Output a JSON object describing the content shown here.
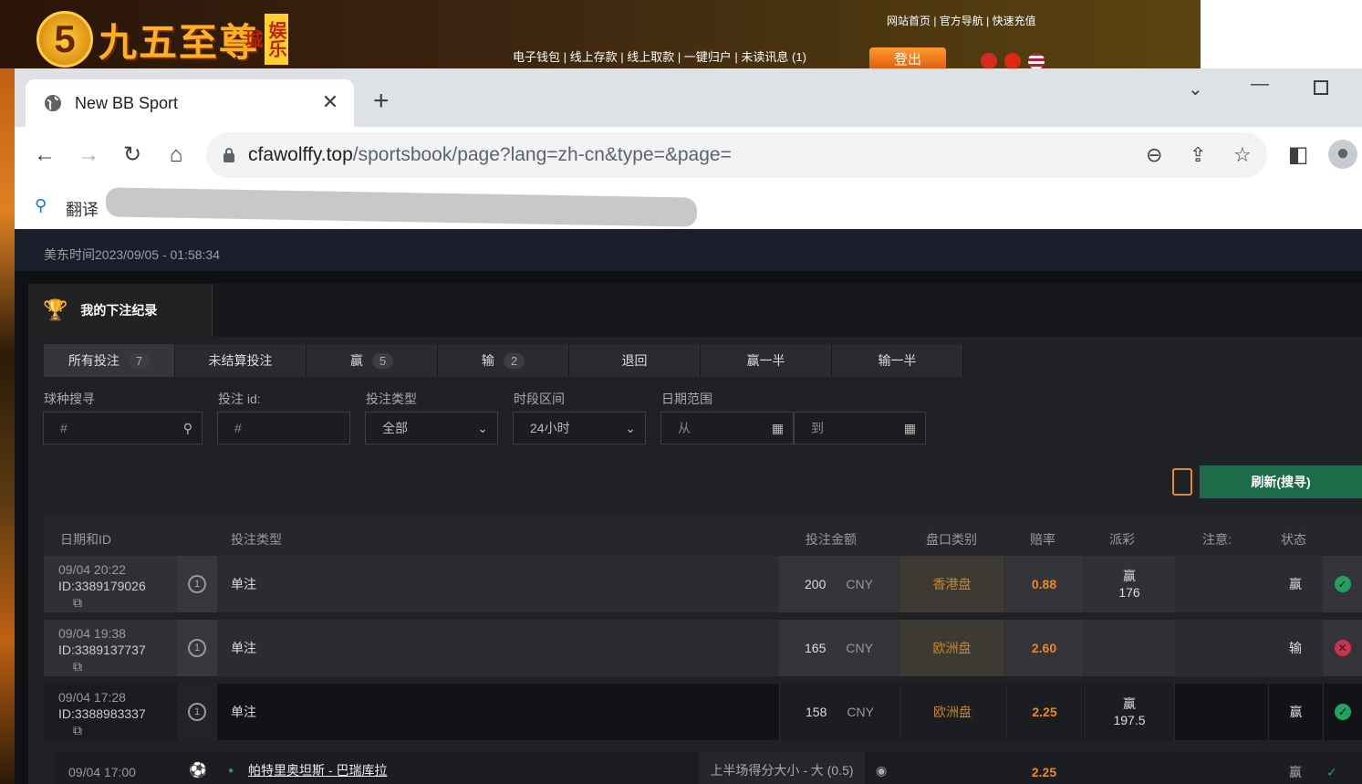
{
  "site": {
    "logo_number": "5",
    "logo_text": "九五至尊",
    "logo_tag": "娱乐城",
    "top_links": "网站首页 | 官方导航 | 快速充值",
    "mid_links": "电子钱包 | 线上存款 | 线上取款 | 一键归户 | 未读讯息 (1)",
    "logout": "登出"
  },
  "browser": {
    "tab_title": "New BB Sport",
    "url_host": "cfawolffy.top",
    "url_path": "/sportsbook/page?lang=zh-cn&type=&page=",
    "translate_label": "翻译"
  },
  "page": {
    "time": "美东时间2023/09/05 - 01:58:34",
    "section_title": "我的下注纪录",
    "filter_tabs": [
      {
        "label": "所有投注",
        "count": "7"
      },
      {
        "label": "未结算投注",
        "count": ""
      },
      {
        "label": "赢",
        "count": "5"
      },
      {
        "label": "输",
        "count": "2"
      },
      {
        "label": "退回",
        "count": ""
      },
      {
        "label": "赢一半",
        "count": ""
      },
      {
        "label": "输一半",
        "count": ""
      }
    ],
    "labels": {
      "sport": "球种搜寻",
      "bet_id": "投注 id:",
      "bet_type": "投注类型",
      "period": "时段区间",
      "date_range": "日期范围"
    },
    "inputs": {
      "sport_placeholder": "#",
      "id_placeholder": "#",
      "bet_type_value": "全部",
      "period_value": "24小时",
      "from": "从",
      "to": "到"
    },
    "refresh": "刷新(搜寻)",
    "columns": [
      "日期和ID",
      "投注类型",
      "投注金额",
      "盘口类别",
      "赔率",
      "派彩",
      "注意:",
      "状态"
    ],
    "rows": [
      {
        "date": "09/04 20:22",
        "id": "ID:3389179026",
        "num": "1",
        "type": "单注",
        "amount": "200",
        "currency": "CNY",
        "market": "香港盘",
        "odds": "0.88",
        "payout_label": "赢",
        "payout": "176",
        "status": "赢",
        "result": "win"
      },
      {
        "date": "09/04 19:38",
        "id": "ID:3389137737",
        "num": "1",
        "type": "单注",
        "amount": "165",
        "currency": "CNY",
        "market": "欧洲盘",
        "odds": "2.60",
        "payout_label": "",
        "payout": "",
        "status": "输",
        "result": "loss"
      },
      {
        "date": "09/04 17:28",
        "id": "ID:3388983337",
        "num": "1",
        "type": "单注",
        "amount": "158",
        "currency": "CNY",
        "market": "欧洲盘",
        "odds": "2.25",
        "payout_label": "赢",
        "payout": "197.5",
        "status": "赢",
        "result": "win"
      }
    ],
    "detail": {
      "date": "09/04 17:00",
      "match": "帕特里奥坦斯 - 巴瑞库拉",
      "market": "上半场得分大小 - 大 (0.5)",
      "odds": "2.25",
      "status": "赢"
    }
  }
}
